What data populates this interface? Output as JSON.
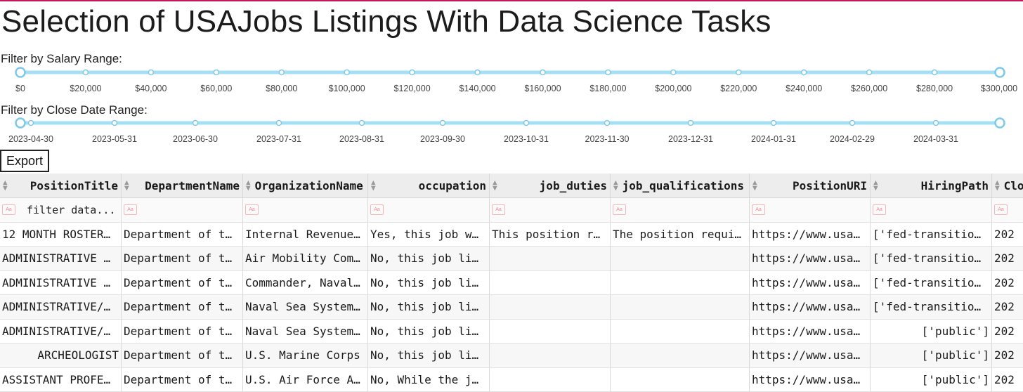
{
  "title": "Selection of USAJobs Listings With Data Science Tasks",
  "salary_filter": {
    "label": "Filter by Salary Range:",
    "ticks": [
      "$0",
      "$20,000",
      "$40,000",
      "$60,000",
      "$80,000",
      "$100,000",
      "$120,000",
      "$140,000",
      "$160,000",
      "$180,000",
      "$200,000",
      "$220,000",
      "$240,000",
      "$260,000",
      "$280,000",
      "$300,000"
    ],
    "min_value": "$0",
    "max_value": "$300,000"
  },
  "date_filter": {
    "label": "Filter by Close Date Range:",
    "ticks": [
      "2023-04-30",
      "2023-05-31",
      "2023-06-30",
      "2023-07-31",
      "2023-08-31",
      "2023-09-30",
      "2023-10-31",
      "2023-11-30",
      "2023-12-31",
      "2024-01-31",
      "2024-02-29",
      "2024-03-31"
    ]
  },
  "export_label": "Export",
  "table": {
    "columns": [
      "PositionTitle",
      "DepartmentName",
      "OrganizationName",
      "occupation",
      "job_duties",
      "job_qualifications",
      "PositionURI",
      "HiringPath",
      "Clo"
    ],
    "filter_placeholder": "filter data...",
    "filter_icon_text": "Aa",
    "rows": [
      [
        "12 MONTH ROSTER…",
        "Department of t…",
        "Internal Revenue…",
        "Yes, this job w…",
        "This position r…",
        "The position requi…",
        "https://www.usa…",
        "['fed-transitio…",
        "202"
      ],
      [
        "ADMINISTRATIVE …",
        "Department of t…",
        "Air Mobility Com…",
        "No, this job li…",
        "",
        "",
        "https://www.usa…",
        "['fed-transitio…",
        "202"
      ],
      [
        "ADMINISTRATIVE …",
        "Department of t…",
        "Commander, Naval…",
        "No, this job li…",
        "",
        "",
        "https://www.usa…",
        "['fed-transitio…",
        "202"
      ],
      [
        "ADMINISTRATIVE/…",
        "Department of t…",
        "Naval Sea System…",
        "No, this job li…",
        "",
        "",
        "https://www.usa…",
        "['fed-transitio…",
        "202"
      ],
      [
        "ADMINISTRATIVE/…",
        "Department of t…",
        "Naval Sea System…",
        "No, this job li…",
        "",
        "",
        "https://www.usa…",
        "['public']",
        "202"
      ],
      [
        "ARCHEOLOGIST",
        "Department of t…",
        "U.S. Marine Corps",
        "No, this job li…",
        "",
        "",
        "https://www.usa…",
        "['public']",
        "202"
      ],
      [
        "ASSISTANT PROFE…",
        "Department of t…",
        "U.S. Air Force A…",
        "No, While the j…",
        "",
        "",
        "https://www.usa…",
        "['public']",
        "202"
      ]
    ]
  },
  "colors": {
    "slider_track": "#a5dff5",
    "slider_handle": "#7dc9ec",
    "accent_top": "#c2185b",
    "filter_icon": "#f08a96"
  }
}
